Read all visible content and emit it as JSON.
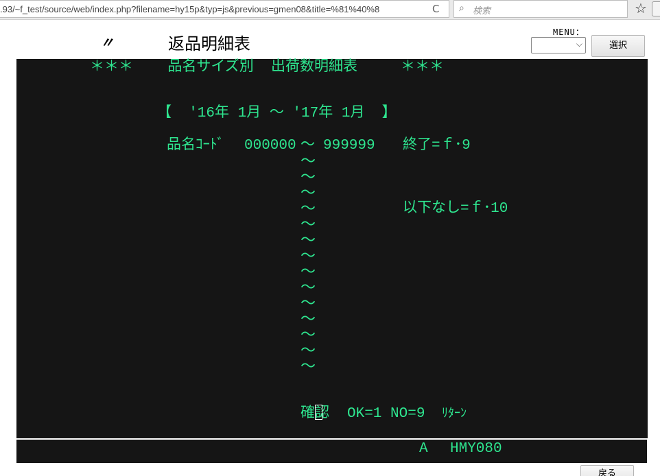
{
  "browser": {
    "url": ".93/~f_test/source/web/index.php?filename=hy15p&typ=js&previous=gmen08&title=%81%40%8",
    "search_placeholder": "検索",
    "reload_glyph": "C",
    "star_glyph": "☆",
    "search_glyph": "🔍"
  },
  "header": {
    "ditto_mark": "〃",
    "title": "返品明細表",
    "menu_label": "MENU：",
    "menu_selected": "",
    "select_button": "選択"
  },
  "terminal": {
    "line1": "＊＊＊    品名サイズ別  出荷数明細表     ＊＊＊",
    "period": "【  '16年 1月 ～ '17年 1月  】",
    "code_label": "品名ｺｰﾄﾞ",
    "code_from": "000000",
    "range_sep": "～",
    "code_to": "999999",
    "end_key": "終了=ｆ･9",
    "none_below_key": "以下なし=ｆ･10",
    "confirm_label": "確認",
    "confirm_options": "OK=1 NO=9",
    "return_label": "ﾘﾀｰﾝ",
    "tilde_rows": [
      "～",
      "～",
      "～",
      "～",
      "～",
      "～",
      "～",
      "～",
      "～",
      "～",
      "～",
      "～",
      "～",
      "～"
    ]
  },
  "statusbar": {
    "mode": "A",
    "screen_id": "HMY080"
  },
  "footer": {
    "back_button": "戻る"
  },
  "colors": {
    "terminal_bg": "#151515",
    "terminal_text": "#2ee58f"
  }
}
